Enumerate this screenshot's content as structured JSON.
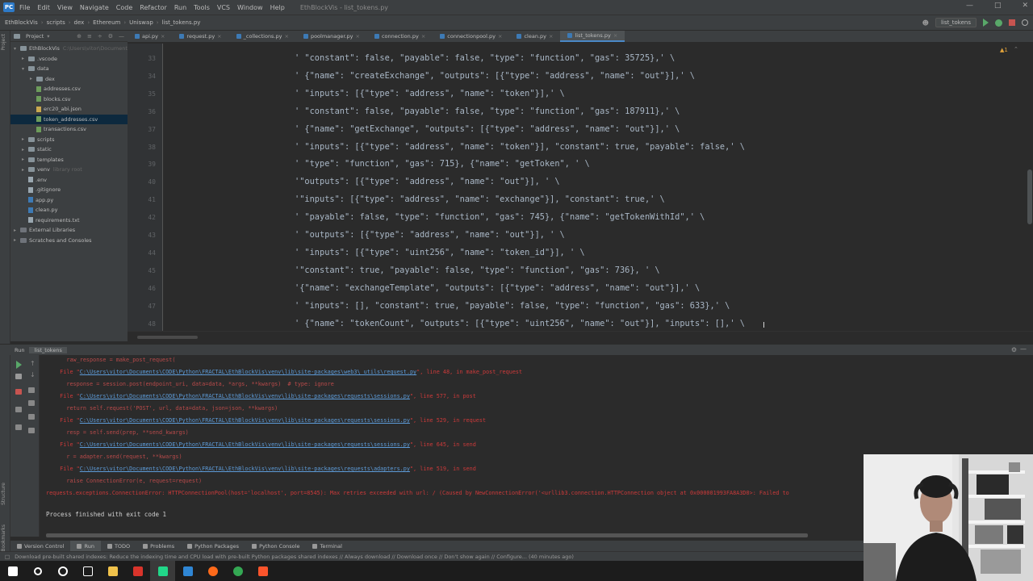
{
  "titlebar": {
    "menu": [
      "File",
      "Edit",
      "View",
      "Navigate",
      "Code",
      "Refactor",
      "Run",
      "Tools",
      "VCS",
      "Window",
      "Help"
    ],
    "title": "EthBlockVis - list_tokens.py"
  },
  "navbar": {
    "breadcrumbs": [
      "EthBlockVis",
      "scripts",
      "dex",
      "Ethereum",
      "Uniswap",
      "list_tokens.py"
    ],
    "run_config": "list_tokens"
  },
  "project": {
    "title": "Project",
    "items": [
      {
        "label": "EthBlockVis",
        "extra": "C:\\Users\\vitor\\Documents\\CODE\\Python\\FRACTAL\\EthBlockVis",
        "type": "folder",
        "depth": 0,
        "open": true
      },
      {
        "label": ".vscode",
        "type": "folder",
        "depth": 1,
        "open": false
      },
      {
        "label": "data",
        "type": "folder",
        "depth": 1,
        "open": true
      },
      {
        "label": "dex",
        "type": "folder",
        "depth": 2,
        "open": false
      },
      {
        "label": "addresses.csv",
        "type": "csv",
        "depth": 2
      },
      {
        "label": "blocks.csv",
        "type": "csv",
        "depth": 2
      },
      {
        "label": "erc20_abi.json",
        "type": "json",
        "depth": 2
      },
      {
        "label": "token_addresses.csv",
        "type": "csv",
        "depth": 2,
        "selected": true
      },
      {
        "label": "transactions.csv",
        "type": "csv",
        "depth": 2
      },
      {
        "label": "scripts",
        "type": "folder",
        "depth": 1,
        "open": false
      },
      {
        "label": "static",
        "type": "folder",
        "depth": 1,
        "open": false
      },
      {
        "label": "templates",
        "type": "folder",
        "depth": 1,
        "open": false
      },
      {
        "label": "venv",
        "extra": "library root",
        "type": "folder",
        "depth": 1,
        "open": false
      },
      {
        "label": ".env",
        "type": "file",
        "depth": 1
      },
      {
        "label": ".gitignore",
        "type": "file",
        "depth": 1
      },
      {
        "label": "app.py",
        "type": "py",
        "depth": 1
      },
      {
        "label": "clean.py",
        "type": "py",
        "depth": 1
      },
      {
        "label": "requirements.txt",
        "type": "file",
        "depth": 1
      },
      {
        "label": "External Libraries",
        "type": "lib",
        "depth": 0,
        "open": false
      },
      {
        "label": "Scratches and Consoles",
        "type": "lib",
        "depth": 0
      }
    ]
  },
  "tabs": [
    "api.py",
    "request.py",
    "_collections.py",
    "poolmanager.py",
    "connection.py",
    "connectionpool.py",
    "clean.py",
    "list_tokens.py"
  ],
  "active_tab": "list_tokens.py",
  "editor": {
    "lines": [
      {
        "n": "33",
        "text": "' \"constant\": false, \"payable\": false, \"type\": \"function\", \"gas\": 35725},' \\"
      },
      {
        "n": "34",
        "text": "' {\"name\": \"createExchange\", \"outputs\": [{\"type\": \"address\", \"name\": \"out\"}],' \\"
      },
      {
        "n": "35",
        "text": "' \"inputs\": [{\"type\": \"address\", \"name\": \"token\"}],' \\"
      },
      {
        "n": "36",
        "text": "' \"constant\": false, \"payable\": false, \"type\": \"function\", \"gas\": 187911},' \\"
      },
      {
        "n": "37",
        "text": "' {\"name\": \"getExchange\", \"outputs\": [{\"type\": \"address\", \"name\": \"out\"}],' \\"
      },
      {
        "n": "38",
        "text": "' \"inputs\": [{\"type\": \"address\", \"name\": \"token\"}], \"constant\": true, \"payable\": false,' \\"
      },
      {
        "n": "39",
        "text": "' \"type\": \"function\", \"gas\": 715}, {\"name\": \"getToken\", ' \\"
      },
      {
        "n": "40",
        "text": "'\"outputs\": [{\"type\": \"address\", \"name\": \"out\"}], ' \\"
      },
      {
        "n": "41",
        "text": "'\"inputs\": [{\"type\": \"address\", \"name\": \"exchange\"}], \"constant\": true,' \\"
      },
      {
        "n": "42",
        "text": "' \"payable\": false, \"type\": \"function\", \"gas\": 745}, {\"name\": \"getTokenWithId\",' \\"
      },
      {
        "n": "43",
        "text": "' \"outputs\": [{\"type\": \"address\", \"name\": \"out\"}], ' \\"
      },
      {
        "n": "44",
        "text": "' \"inputs\": [{\"type\": \"uint256\", \"name\": \"token_id\"}], ' \\"
      },
      {
        "n": "45",
        "text": "'\"constant\": true, \"payable\": false, \"type\": \"function\", \"gas\": 736}, ' \\"
      },
      {
        "n": "46",
        "text": "'{\"name\": \"exchangeTemplate\", \"outputs\": [{\"type\": \"address\", \"name\": \"out\"}],' \\"
      },
      {
        "n": "47",
        "text": "' \"inputs\": [], \"constant\": true, \"payable\": false, \"type\": \"function\", \"gas\": 633},' \\"
      },
      {
        "n": "48",
        "text": "' {\"name\": \"tokenCount\", \"outputs\": [{\"type\": \"uint256\", \"name\": \"out\"}], \"inputs\": [],' \\"
      }
    ]
  },
  "run_panel": {
    "label": "Run",
    "tab": "list_tokens"
  },
  "console": {
    "lines": [
      {
        "kind": "dim",
        "text": "    raw_response = make_post_request("
      },
      {
        "kind": "file",
        "pre": "  File \"",
        "link": "C:\\Users\\vitor\\Documents\\CODE\\Python\\FRACTAL\\EthBlockVis\\venv\\lib\\site-packages\\web3\\_utils\\request.py",
        "post": "\", line 48, in make_post_request"
      },
      {
        "kind": "dim",
        "text": "    response = session.post(endpoint_uri, data=data, *args, **kwargs)  # type: ignore"
      },
      {
        "kind": "file",
        "pre": "  File \"",
        "link": "C:\\Users\\vitor\\Documents\\CODE\\Python\\FRACTAL\\EthBlockVis\\venv\\lib\\site-packages\\requests\\sessions.py",
        "post": "\", line 577, in post"
      },
      {
        "kind": "dim",
        "text": "    return self.request('POST', url, data=data, json=json, **kwargs)"
      },
      {
        "kind": "file",
        "pre": "  File \"",
        "link": "C:\\Users\\vitor\\Documents\\CODE\\Python\\FRACTAL\\EthBlockVis\\venv\\lib\\site-packages\\requests\\sessions.py",
        "post": "\", line 529, in request"
      },
      {
        "kind": "dim",
        "text": "    resp = self.send(prep, **send_kwargs)"
      },
      {
        "kind": "file",
        "pre": "  File \"",
        "link": "C:\\Users\\vitor\\Documents\\CODE\\Python\\FRACTAL\\EthBlockVis\\venv\\lib\\site-packages\\requests\\sessions.py",
        "post": "\", line 645, in send"
      },
      {
        "kind": "dim",
        "text": "    r = adapter.send(request, **kwargs)"
      },
      {
        "kind": "file",
        "pre": "  File \"",
        "link": "C:\\Users\\vitor\\Documents\\CODE\\Python\\FRACTAL\\EthBlockVis\\venv\\lib\\site-packages\\requests\\adapters.py",
        "post": "\", line 519, in send"
      },
      {
        "kind": "dim",
        "text": "    raise ConnectionError(e, request=request)"
      },
      {
        "kind": "err",
        "text": "requests.exceptions.ConnectionError: HTTPConnectionPool(host='localhost', port=8545): Max retries exceeded with url: / (Caused by NewConnectionError('<urllib3.connection.HTTPConnection object at 0x000001993FA8A3D0>: Failed to"
      },
      {
        "kind": "blank",
        "text": ""
      },
      {
        "kind": "normal",
        "text": "Process finished with exit code 1"
      }
    ]
  },
  "bottom_tabs": [
    "Version Control",
    "Run",
    "TODO",
    "Problems",
    "Python Packages",
    "Python Console",
    "Terminal"
  ],
  "active_bottom_tab": "Run",
  "status": {
    "message": "Download pre-built shared indexes: Reduce the indexing time and CPU load with pre-built Python packages shared indexes // Always download // Download once // Don't show again // Configure... (40 minutes ago)"
  },
  "taskbar": {
    "apps": [
      {
        "name": "windows-start",
        "color": "#ffffff"
      },
      {
        "name": "search",
        "color": "#ffffff"
      },
      {
        "name": "cortana",
        "color": "#ffffff"
      },
      {
        "name": "task-view",
        "color": "#ffffff"
      },
      {
        "name": "file-explorer",
        "color": "#f0c24b"
      },
      {
        "name": "unknown-red-app",
        "color": "#d9342b"
      },
      {
        "name": "pycharm",
        "color": "#21d789"
      },
      {
        "name": "vscode",
        "color": "#2f86d4"
      },
      {
        "name": "firefox",
        "color": "#ff6a1a"
      },
      {
        "name": "chrome",
        "color": "#34a853"
      },
      {
        "name": "brave",
        "color": "#fb542b"
      }
    ]
  },
  "colors": {
    "accent": "#4a88c7",
    "error": "#cc3a3a",
    "link": "#5d9bd8",
    "selected": "#0d293e"
  }
}
